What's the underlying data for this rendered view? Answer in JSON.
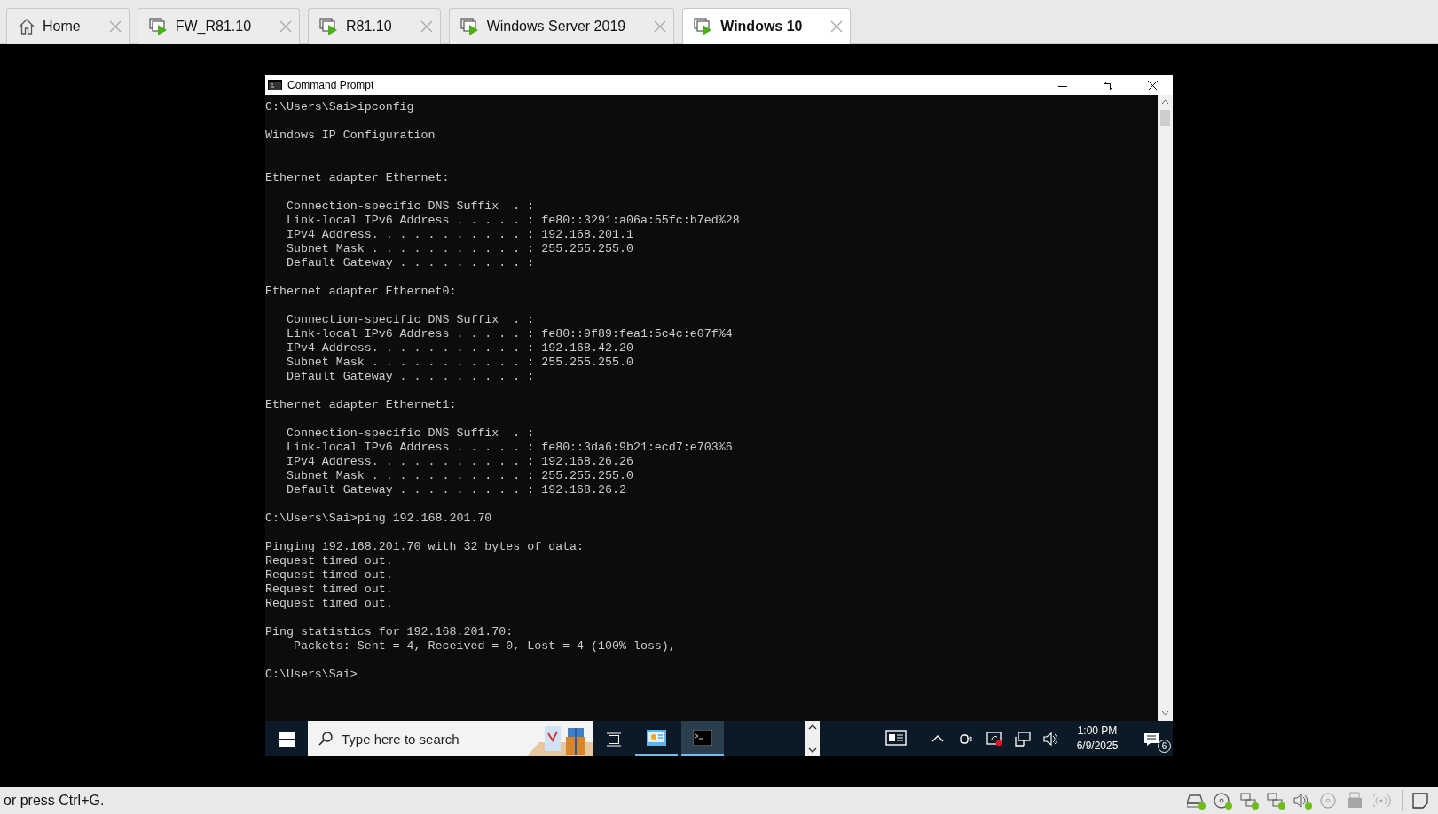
{
  "tabs": [
    {
      "label": "Home",
      "kind": "home",
      "selected": false
    },
    {
      "label": "FW_R81.10",
      "kind": "vm",
      "selected": false
    },
    {
      "label": "R81.10",
      "kind": "vm",
      "selected": false
    },
    {
      "label": "Windows Server 2019",
      "kind": "vm",
      "selected": false
    },
    {
      "label": "Windows 10",
      "kind": "vm",
      "selected": true
    }
  ],
  "console_window": {
    "title": "Command Prompt",
    "lines": [
      {
        "kind": "text",
        "text": "C:\\Users\\Sai>ipconfig"
      },
      {
        "kind": "blank"
      },
      {
        "kind": "text",
        "text": "Windows IP Configuration"
      },
      {
        "kind": "blank"
      },
      {
        "kind": "blank"
      },
      {
        "kind": "text",
        "text": "Ethernet adapter Ethernet:"
      },
      {
        "kind": "blank"
      },
      {
        "kind": "text",
        "text": "   Connection-specific DNS Suffix  . :"
      },
      {
        "kind": "text",
        "text": "   Link-local IPv6 Address . . . . . : fe80::3291:a06a:55fc:b7ed%28"
      },
      {
        "kind": "text",
        "text": "   IPv4 Address. . . . . . . . . . . : 192.168.201.1"
      },
      {
        "kind": "text",
        "text": "   Subnet Mask . . . . . . . . . . . : 255.255.255.0"
      },
      {
        "kind": "text",
        "text": "   Default Gateway . . . . . . . . . :"
      },
      {
        "kind": "blank"
      },
      {
        "kind": "text",
        "text": "Ethernet adapter Ethernet0:"
      },
      {
        "kind": "blank"
      },
      {
        "kind": "text",
        "text": "   Connection-specific DNS Suffix  . :"
      },
      {
        "kind": "text",
        "text": "   Link-local IPv6 Address . . . . . : fe80::9f89:fea1:5c4c:e07f%4"
      },
      {
        "kind": "text",
        "text": "   IPv4 Address. . . . . . . . . . . : 192.168.42.20"
      },
      {
        "kind": "text",
        "text": "   Subnet Mask . . . . . . . . . . . : 255.255.255.0"
      },
      {
        "kind": "text",
        "text": "   Default Gateway . . . . . . . . . :"
      },
      {
        "kind": "blank"
      },
      {
        "kind": "text",
        "text": "Ethernet adapter Ethernet1:"
      },
      {
        "kind": "blank"
      },
      {
        "kind": "text",
        "text": "   Connection-specific DNS Suffix  . :"
      },
      {
        "kind": "text",
        "text": "   Link-local IPv6 Address . . . . . : fe80::3da6:9b21:ecd7:e703%6"
      },
      {
        "kind": "text",
        "text": "   IPv4 Address. . . . . . . . . . . : 192.168.26.26"
      },
      {
        "kind": "text",
        "text": "   Subnet Mask . . . . . . . . . . . : 255.255.255.0"
      },
      {
        "kind": "text",
        "text": "   Default Gateway . . . . . . . . . : 192.168.26.2"
      },
      {
        "kind": "blank"
      },
      {
        "kind": "text",
        "text": "C:\\Users\\Sai>ping 192.168.201.70"
      },
      {
        "kind": "blank"
      },
      {
        "kind": "text",
        "text": "Pinging 192.168.201.70 with 32 bytes of data:"
      },
      {
        "kind": "text",
        "text": "Request timed out."
      },
      {
        "kind": "text",
        "text": "Request timed out."
      },
      {
        "kind": "text",
        "text": "Request timed out."
      },
      {
        "kind": "text",
        "text": "Request timed out."
      },
      {
        "kind": "blank"
      },
      {
        "kind": "text",
        "text": "Ping statistics for 192.168.201.70:"
      },
      {
        "kind": "text",
        "text": "    Packets: Sent = 4, Received = 0, Lost = 4 (100% loss),"
      },
      {
        "kind": "blank"
      },
      {
        "kind": "text",
        "text": "C:\\Users\\Sai>"
      }
    ]
  },
  "taskbar": {
    "search": {
      "placeholder": "Type here to search"
    },
    "apps": [
      {
        "kind": "app",
        "selected": false
      },
      {
        "kind": "console",
        "selected": true
      }
    ],
    "clock": {
      "time": "1:00 PM",
      "date": "6/9/2025"
    },
    "notifications": {
      "count": "6"
    }
  },
  "status_bar": {
    "hint": "or press Ctrl+G.",
    "devices": [
      {
        "kind": "disk",
        "active": true
      },
      {
        "kind": "cd",
        "active": true
      },
      {
        "kind": "network",
        "active": true
      },
      {
        "kind": "network",
        "active": true
      },
      {
        "kind": "sound",
        "active": true
      },
      {
        "kind": "cd",
        "active": false
      },
      {
        "kind": "usb",
        "active": false
      },
      {
        "kind": "wireless",
        "active": false
      }
    ]
  }
}
